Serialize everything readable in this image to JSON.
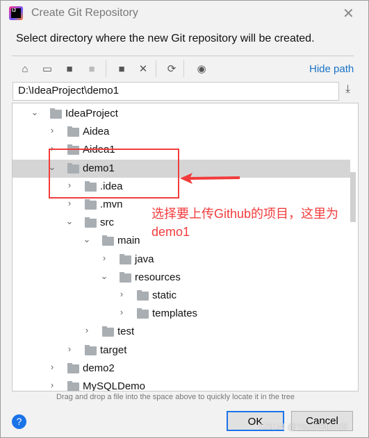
{
  "window": {
    "title": "Create Git Repository",
    "close": "✕"
  },
  "description": "Select directory where the new Git repository will be created.",
  "toolbar": {
    "icons": [
      "home-icon",
      "desktop-icon",
      "project-folder-icon",
      "module-folder-icon",
      "new-folder-icon",
      "delete-icon",
      "refresh-icon",
      "show-hidden-icon"
    ],
    "hide_path": "Hide path"
  },
  "path": "D:\\IdeaProject\\demo1",
  "tree": [
    {
      "label": "IdeaProject",
      "level": 0,
      "expanded": true
    },
    {
      "label": "Aidea",
      "level": 1,
      "expanded": false
    },
    {
      "label": "Aidea1",
      "level": 1,
      "expanded": false
    },
    {
      "label": "demo1",
      "level": 1,
      "expanded": true,
      "selected": true
    },
    {
      "label": ".idea",
      "level": 2,
      "expanded": false
    },
    {
      "label": ".mvn",
      "level": 2,
      "expanded": false
    },
    {
      "label": "src",
      "level": 2,
      "expanded": true
    },
    {
      "label": "main",
      "level": 3,
      "expanded": true
    },
    {
      "label": "java",
      "level": 4,
      "expanded": false
    },
    {
      "label": "resources",
      "level": 4,
      "expanded": true
    },
    {
      "label": "static",
      "level": 5,
      "expanded": false
    },
    {
      "label": "templates",
      "level": 5,
      "expanded": false
    },
    {
      "label": "test",
      "level": 3,
      "expanded": false
    },
    {
      "label": "target",
      "level": 2,
      "expanded": false
    },
    {
      "label": "demo2",
      "level": 1,
      "expanded": false
    },
    {
      "label": "MySQLDemo",
      "level": 1,
      "expanded": false
    }
  ],
  "annotation": {
    "text": "选择要上传Github的项目，这里为demo1",
    "color": "#f23c3c"
  },
  "hint": "Drag and drop a file into the space above to quickly locate it in the tree",
  "buttons": {
    "ok": "OK",
    "cancel": "Cancel",
    "help": "?"
  },
  "watermark": "CSDN @YouthBlood9"
}
